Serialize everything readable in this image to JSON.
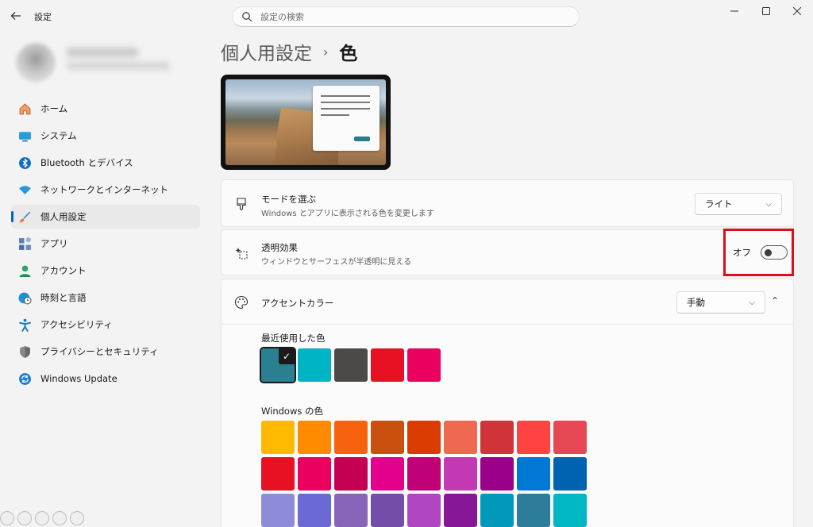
{
  "app": {
    "title": "設定"
  },
  "search": {
    "placeholder": "設定の検索"
  },
  "sidebar": {
    "items": [
      {
        "label": "ホーム",
        "icon": "home-icon",
        "color": "#e8743b"
      },
      {
        "label": "システム",
        "icon": "monitor-icon",
        "color": "#0f7fc4"
      },
      {
        "label": "Bluetooth とデバイス",
        "icon": "bluetooth-icon",
        "color": "#0f6cbd"
      },
      {
        "label": "ネットワークとインターネット",
        "icon": "wifi-icon",
        "color": "#1a8ad4"
      },
      {
        "label": "個人用設定",
        "icon": "brush-icon",
        "color": "#d26a2a"
      },
      {
        "label": "アプリ",
        "icon": "apps-icon",
        "color": "#4a6fa5"
      },
      {
        "label": "アカウント",
        "icon": "person-icon",
        "color": "#2aa36a"
      },
      {
        "label": "時刻と言語",
        "icon": "globe-clock-icon",
        "color": "#1486c8"
      },
      {
        "label": "アクセシビリティ",
        "icon": "accessibility-icon",
        "color": "#1478c8"
      },
      {
        "label": "プライバシーとセキュリティ",
        "icon": "shield-icon",
        "color": "#7c7c7c"
      },
      {
        "label": "Windows Update",
        "icon": "update-icon",
        "color": "#0f6cbd"
      }
    ],
    "active_index": 4
  },
  "breadcrumb": {
    "parent": "個人用設定",
    "separator": "›",
    "current": "色"
  },
  "mode": {
    "title": "モードを選ぶ",
    "subtitle": "Windows とアプリに表示される色を変更します",
    "value": "ライト"
  },
  "transparency": {
    "title": "透明効果",
    "subtitle": "ウィンドウとサーフェスが半透明に見える",
    "state_label": "オフ",
    "on": false
  },
  "accent": {
    "title": "アクセントカラー",
    "value": "手動",
    "recent_label": "最近使用した色",
    "recent_colors": [
      "#2a7f90",
      "#00b4c4",
      "#4c4a48",
      "#e81123",
      "#ea005e"
    ],
    "windows_label": "Windows の色",
    "windows_colors": [
      [
        "#ffb900",
        "#ff8c00",
        "#f7630c",
        "#ca5010",
        "#da3b01",
        "#ef6950",
        "#d13438",
        "#ff4343",
        "#e74856"
      ],
      [
        "#e81123",
        "#ea005e",
        "#c30052",
        "#e3008c",
        "#bf0077",
        "#c239b3",
        "#9a0089",
        "#0078d4",
        "#0063b1"
      ],
      [
        "#8e8cd8",
        "#6b69d6",
        "#8764b8",
        "#744da9",
        "#b146c2",
        "#881798",
        "#0099bc",
        "#2d7d9a",
        "#00b7c3"
      ]
    ]
  }
}
